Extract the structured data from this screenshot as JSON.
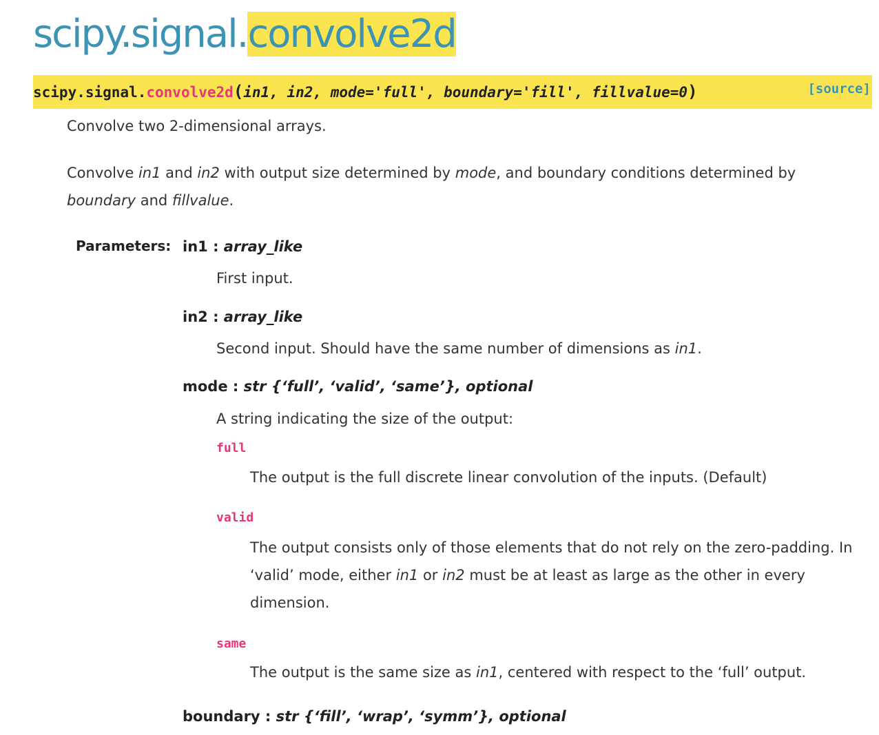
{
  "title": {
    "prefix": "scipy.signal.",
    "highlight": "convolve2d"
  },
  "signature": {
    "module": "scipy.signal.",
    "function": "convolve2d",
    "open_paren": "(",
    "params": "in1, in2, mode='full', boundary='fill', fillvalue=0",
    "close_paren": ")",
    "source_link": "[source]"
  },
  "summary": "Convolve two 2-dimensional arrays.",
  "description": {
    "p1": "Convolve ",
    "in1": "in1",
    "p2": " and ",
    "in2": "in2",
    "p3": " with output size determined by ",
    "mode": "mode",
    "p4": ", and boundary conditions determined by",
    "boundary": "boundary",
    "p5": " and ",
    "fillvalue": "fillvalue",
    "p6": "."
  },
  "params_label": "Parameters:",
  "params": {
    "in1": {
      "name": "in1",
      "sep": " : ",
      "type": "array_like",
      "desc": "First input."
    },
    "in2": {
      "name": "in2",
      "sep": " : ",
      "type": "array_like",
      "desc_a": "Second input. Should have the same number of dimensions as ",
      "desc_ref": "in1",
      "desc_b": "."
    },
    "mode": {
      "name": "mode",
      "sep": " : ",
      "type": "str {‘full’, ‘valid’, ‘same’}, optional",
      "desc": "A string indicating the size of the output:",
      "options": {
        "full": {
          "key": "full",
          "desc": "The output is the full discrete linear convolution of the inputs. (Default)"
        },
        "valid": {
          "key": "valid",
          "line1": "The output consists only of those elements that do not rely on the zero-padding. In",
          "line2a": "‘valid’ mode, either ",
          "line2_in1": "in1",
          "line2b": " or ",
          "line2_in2": "in2",
          "line2c": " must be at least as large as the other in every",
          "line3": "dimension."
        },
        "same": {
          "key": "same",
          "desc_a": "The output is the same size as ",
          "desc_ref": "in1",
          "desc_b": ", centered with respect to the ‘full’ output."
        }
      }
    },
    "boundary": {
      "name": "boundary",
      "sep": " : ",
      "type": "str {‘fill’, ‘wrap’, ‘symm’}, optional"
    }
  }
}
